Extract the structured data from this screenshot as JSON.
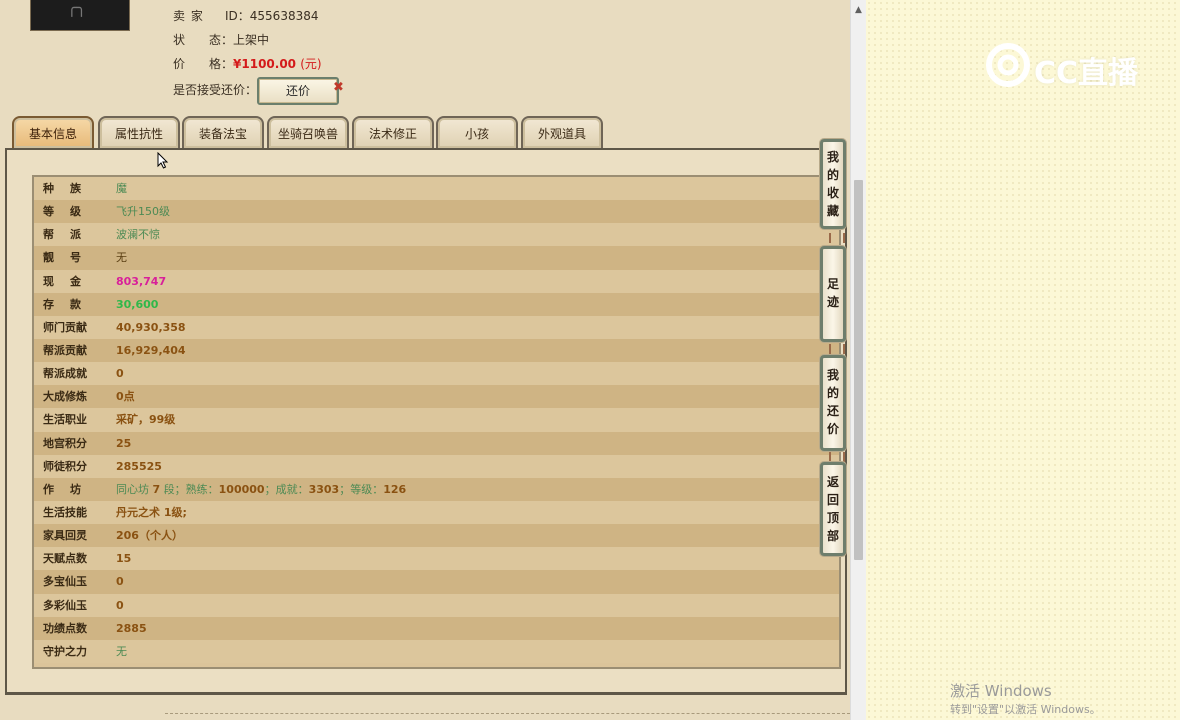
{
  "seller": {
    "seller_label": "卖 家",
    "seller_id_label": "ID：",
    "seller_id": "455638384",
    "status_label": "状　　态：",
    "status": "上架中",
    "price_label": "价　　格：",
    "price": "¥1100.00",
    "price_unit": "(元)",
    "bargain_label": "是否接受还价：",
    "bargain_button": "还价",
    "bargain_x": "✖"
  },
  "tabs": [
    {
      "label": "基本信息",
      "active": true
    },
    {
      "label": "属性抗性"
    },
    {
      "label": "装备法宝"
    },
    {
      "label": "坐骑召唤兽"
    },
    {
      "label": "法术修正"
    },
    {
      "label": "小孩"
    },
    {
      "label": "外观道具"
    }
  ],
  "rows": [
    {
      "key": "种族",
      "value": "魔",
      "style": "green"
    },
    {
      "key": "等级",
      "value": "飞升150级",
      "style": "green"
    },
    {
      "key": "帮派",
      "value": "波澜不惊",
      "style": "green"
    },
    {
      "key": "靓号",
      "value": "无",
      "style": ""
    },
    {
      "key": "现金",
      "value": "803,747",
      "style": "magenta"
    },
    {
      "key": "存款",
      "value": "30,600",
      "style": "bgreen"
    },
    {
      "key": "师门贡献",
      "value": "40,930,358",
      "style": "brown"
    },
    {
      "key": "帮派贡献",
      "value": "16,929,404",
      "style": "brown"
    },
    {
      "key": "帮派成就",
      "value": "0",
      "style": "brown"
    },
    {
      "key": "大成修炼",
      "value": "0点",
      "style": "brown"
    },
    {
      "key": "生活职业",
      "value": "采矿，99级",
      "style": "brown"
    },
    {
      "key": "地宫积分",
      "value": "25",
      "style": "brown"
    },
    {
      "key": "师徒积分",
      "value": "285525",
      "style": "brown"
    },
    {
      "key": "作坊",
      "value": "",
      "style": "green"
    },
    {
      "key": "生活技能",
      "value": "丹元之术 1级;",
      "style": "brown"
    },
    {
      "key": "家具回灵",
      "value": "206（个人）",
      "style": "brown"
    },
    {
      "key": "天赋点数",
      "value": "15",
      "style": "brown"
    },
    {
      "key": "多宝仙玉",
      "value": "0",
      "style": "brown"
    },
    {
      "key": "多彩仙玉",
      "value": "0",
      "style": "brown"
    },
    {
      "key": "功绩点数",
      "value": "2885",
      "style": "brown"
    },
    {
      "key": "守护之力",
      "value": "无",
      "style": "green"
    }
  ],
  "workshop": {
    "a": "同心坊",
    "b": "7",
    "c": "段；熟练：",
    "d": "100000",
    "e": "；成就：",
    "f": "3303",
    "g": "；等级：",
    "h": "126"
  },
  "side_buttons": [
    {
      "label": [
        "我",
        "的",
        "收",
        "藏"
      ]
    },
    {
      "label": [
        "足",
        "迹"
      ]
    },
    {
      "label": [
        "我",
        "的",
        "还",
        "价"
      ]
    },
    {
      "label": [
        "返",
        "回",
        "顶",
        "部"
      ]
    }
  ],
  "watermark": {
    "logo_text": "CC直播"
  },
  "windows": {
    "line1": "激活 Windows",
    "line2": "转到\"设置\"以激活 Windows。"
  }
}
